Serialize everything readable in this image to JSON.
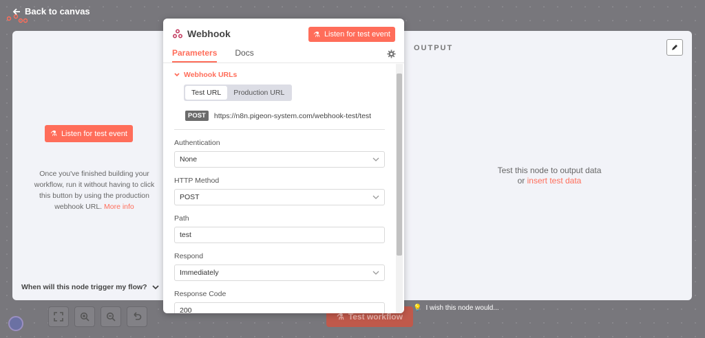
{
  "canvas": {
    "back_label": "Back to canvas",
    "test_workflow_label": "Test workflow",
    "wish_text": "I wish this node would..."
  },
  "input_pane": {
    "listen_label": "Listen for test event",
    "description": "Once you've finished building your workflow, run it without having to click this button by using the production webhook URL.",
    "more_info": "More info",
    "trigger_question": "When will this node trigger my flow?"
  },
  "output_pane": {
    "title": "OUTPUT",
    "message_line1": "Test this node to output data",
    "message_or": "or",
    "insert_link": "insert test data"
  },
  "node": {
    "title": "Webhook",
    "listen_label": "Listen for test event",
    "tabs": [
      "Parameters",
      "Docs"
    ],
    "active_tab": "Parameters",
    "webhook_urls_label": "Webhook URLs",
    "url_tabs": [
      "Test URL",
      "Production URL"
    ],
    "method": "POST",
    "url": "https://n8n.pigeon-system.com/webhook-test/test"
  },
  "fields": {
    "authentication": {
      "label": "Authentication",
      "value": "None"
    },
    "http_method": {
      "label": "HTTP Method",
      "value": "POST"
    },
    "path": {
      "label": "Path",
      "value": "test"
    },
    "respond": {
      "label": "Respond",
      "value": "Immediately"
    },
    "response_code": {
      "label": "Response Code",
      "value": "200"
    }
  },
  "colors": {
    "accent": "#ff6d5a",
    "panel_bg": "#f2f3f8"
  }
}
